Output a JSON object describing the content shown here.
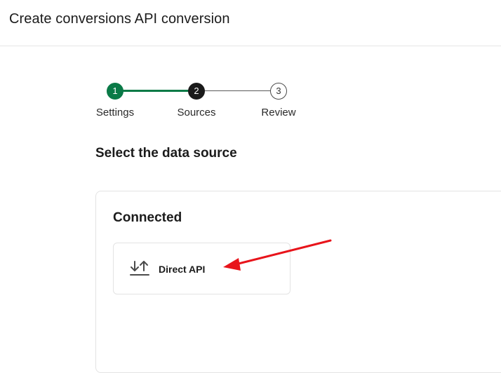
{
  "header": {
    "title": "Create conversions API conversion"
  },
  "stepper": {
    "steps": [
      {
        "number": "1",
        "label": "Settings",
        "state": "completed"
      },
      {
        "number": "2",
        "label": "Sources",
        "state": "current"
      },
      {
        "number": "3",
        "label": "Review",
        "state": "upcoming"
      }
    ]
  },
  "main": {
    "section_title": "Select the data source",
    "connected": {
      "title": "Connected",
      "sources": [
        {
          "label": "Direct API",
          "icon": "upload-download-icon"
        }
      ]
    }
  },
  "colors": {
    "completed": "#0a7a47",
    "current": "#1a1a1a",
    "annotation_arrow": "#e8141b"
  }
}
